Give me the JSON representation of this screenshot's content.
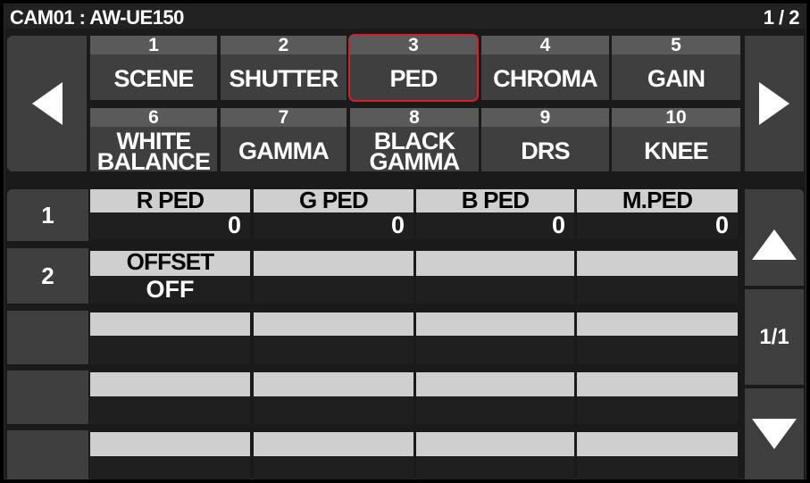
{
  "header": {
    "camera": "CAM01 : AW-UE150",
    "page": "1 / 2"
  },
  "menu": {
    "row1": [
      {
        "num": "1",
        "label": "SCENE"
      },
      {
        "num": "2",
        "label": "SHUTTER"
      },
      {
        "num": "3",
        "label": "PED",
        "selected": true
      },
      {
        "num": "4",
        "label": "CHROMA"
      },
      {
        "num": "5",
        "label": "GAIN"
      }
    ],
    "row2": [
      {
        "num": "6",
        "label1": "WHITE",
        "label2": "BALANCE"
      },
      {
        "num": "7",
        "label": "GAMMA"
      },
      {
        "num": "8",
        "label1": "BLACK",
        "label2": "GAMMA"
      },
      {
        "num": "9",
        "label": "DRS"
      },
      {
        "num": "10",
        "label": "KNEE"
      }
    ]
  },
  "nav": {
    "left_icon": "left-arrow-icon",
    "right_icon": "right-arrow-icon",
    "up_icon": "up-arrow-icon",
    "down_icon": "down-arrow-icon"
  },
  "params": {
    "row1": {
      "index": "1",
      "cells": [
        {
          "name": "R PED",
          "value": "0"
        },
        {
          "name": "G PED",
          "value": "0"
        },
        {
          "name": "B PED",
          "value": "0"
        },
        {
          "name": "M.PED",
          "value": "0"
        }
      ]
    },
    "row2": {
      "index": "2",
      "cells": [
        {
          "name": "OFFSET",
          "value": "OFF"
        }
      ]
    }
  },
  "pager": {
    "label": "1/1"
  },
  "colors": {
    "selected_border": "#d91e2a",
    "button_bg": "#3f3f3f",
    "number_strip": "#5a5a5a",
    "cell_label_bg": "#cfcfcf"
  }
}
